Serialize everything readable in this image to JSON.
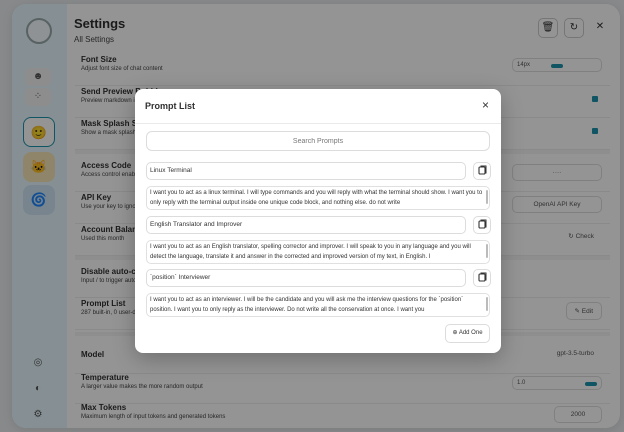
{
  "settings": {
    "title": "Settings",
    "subtitle": "All Settings",
    "rows": {
      "font_size": {
        "title": "Font Size",
        "sub": "Adjust font size of chat content",
        "value": "14px"
      },
      "send_preview": {
        "title": "Send Preview Bubble",
        "sub": "Preview markdown in bubble"
      },
      "mask_splash": {
        "title": "Mask Splash Screen",
        "sub": "Show a mask splash screen before starting new chat"
      },
      "access_code": {
        "title": "Access Code",
        "sub": "Access control enabled",
        "value": "····"
      },
      "api_key": {
        "title": "API Key",
        "sub": "Use your key to ignore access code limit",
        "placeholder": "OpenAI API Key"
      },
      "account_balance": {
        "title": "Account Balance",
        "sub": "Used this month",
        "action": "Check"
      },
      "disable_autocomplete": {
        "title": "Disable auto-completion",
        "sub": "Input / to trigger auto-completion"
      },
      "prompt_list": {
        "title": "Prompt List",
        "sub": "287 built-in, 0 user-defined",
        "action": "Edit"
      },
      "model": {
        "title": "Model",
        "value": "gpt-3.5-turbo"
      },
      "temperature": {
        "title": "Temperature",
        "sub": "A larger value makes the more random output",
        "value": "1.0"
      },
      "max_tokens": {
        "title": "Max Tokens",
        "sub": "Maximum length of input tokens and generated tokens",
        "value": "2000"
      }
    }
  },
  "header_icons": [
    "trash-icon",
    "reload-icon",
    "close-icon"
  ],
  "modal": {
    "title": "Prompt List",
    "close": "×",
    "search_placeholder": "Search Prompts",
    "add_label": "Add One",
    "prompts": [
      {
        "title": "Linux Terminal",
        "body": "I want you to act as a linux terminal. I will type commands and you will reply with what the terminal should show. I want you to only reply with the terminal output inside one unique code block, and nothing else. do not write"
      },
      {
        "title": "English Translator and Improver",
        "body": "I want you to act as an English translator, spelling corrector and improver. I will speak to you in any language and you will detect the language, translate it and answer in the corrected and improved version of my text, in English. I"
      },
      {
        "title": "`position` Interviewer",
        "body": "I want you to act as an interviewer. I will be the candidate and you will ask me the interview questions for the `position` position. I want you to only reply as the interviewer. Do not write all the conservation at once. I want you"
      }
    ]
  },
  "colors": {
    "accent": "#1d93ab",
    "sidebar": "#e7f8ff",
    "overlay": "rgba(0,0,0,0.42)"
  }
}
